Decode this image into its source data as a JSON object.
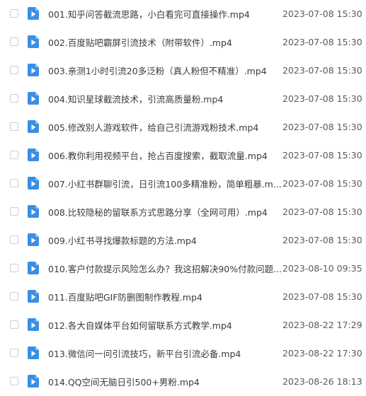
{
  "icons": {
    "file_icon": "video-file-icon",
    "file_icon_color": "#3a8ee6"
  },
  "files": [
    {
      "name": "001.知乎问答截流思路，小白看完可直接操作.mp4",
      "date": "2023-07-08 15:30"
    },
    {
      "name": "002.百度贴吧霸屏引流技术（附带软件）.mp4",
      "date": "2023-07-08 15:30"
    },
    {
      "name": "003.亲测1小时引流20多泛粉（真人粉但不精准）.mp4",
      "date": "2023-07-08 15:30"
    },
    {
      "name": "004.知识星球截流技术，引流高质量粉.mp4",
      "date": "2023-07-08 15:30"
    },
    {
      "name": "005.修改别人游戏软件，给自己引流游戏粉技术.mp4",
      "date": "2023-07-08 15:30"
    },
    {
      "name": "006.教你利用视频平台，抢占百度搜索，截取流量.mp4",
      "date": "2023-07-08 15:30"
    },
    {
      "name": "007.小红书群聊引流，日引流100多精准粉，简单粗暴.m...",
      "date": "2023-07-08 15:30"
    },
    {
      "name": "008.比较隐秘的留联系方式思路分享（全网可用）.mp4",
      "date": "2023-07-08 15:30"
    },
    {
      "name": "009.小红书寻找爆款标题的方法.mp4",
      "date": "2023-07-08 15:30"
    },
    {
      "name": "010.客户付款提示风险怎么办？我这招解决90%付款问题...",
      "date": "2023-08-10 09:35"
    },
    {
      "name": "011.百度贴吧GIF防删图制作教程.mp4",
      "date": "2023-07-08 15:30"
    },
    {
      "name": "012.各大自媒体平台如何留联系方式教学.mp4",
      "date": "2023-08-22 17:29"
    },
    {
      "name": "013.微信问一问引流技巧，新平台引流必备.mp4",
      "date": "2023-08-22 17:30"
    },
    {
      "name": "014.QQ空间无脑日引500+男粉.mp4",
      "date": "2023-08-26 18:13"
    }
  ]
}
